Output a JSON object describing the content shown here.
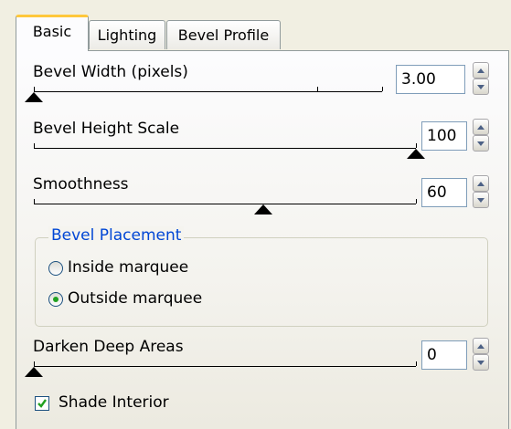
{
  "tabs": [
    {
      "label": "Basic",
      "active": true
    },
    {
      "label": "Lighting",
      "active": false
    },
    {
      "label": "Bevel Profile",
      "active": false
    }
  ],
  "bevel_width": {
    "label": "Bevel Width (pixels)",
    "value": "3.00",
    "slider_fraction": 0.0
  },
  "bevel_height": {
    "label": "Bevel Height Scale",
    "value": "100",
    "slider_fraction": 1.0
  },
  "smoothness": {
    "label": "Smoothness",
    "value": "60",
    "slider_fraction": 0.6
  },
  "placement": {
    "title": "Bevel Placement",
    "options": [
      {
        "label": "Inside marquee",
        "selected": false
      },
      {
        "label": "Outside marquee",
        "selected": true
      }
    ]
  },
  "darken": {
    "label": "Darken Deep Areas",
    "value": "0",
    "slider_fraction": 0.0
  },
  "shade_interior": {
    "label": "Shade Interior",
    "checked": true
  },
  "colors": {
    "accent": "#ffc83c",
    "group_title": "#0046d5",
    "radio_dot": "#21a121",
    "check": "#21a121"
  },
  "icons": {
    "spin_up": "spin-up-icon",
    "spin_down": "spin-down-icon",
    "checkmark": "checkmark-icon"
  }
}
